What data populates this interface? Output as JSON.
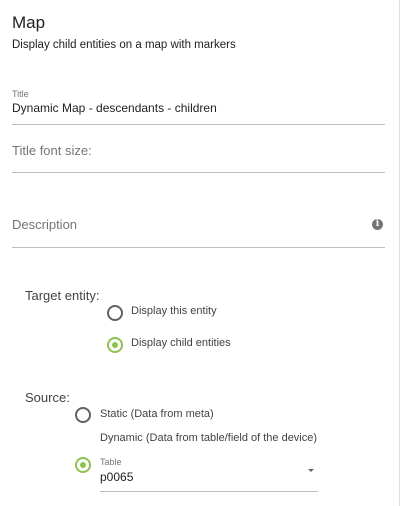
{
  "header": {
    "title": "Map",
    "subtitle": "Display child entities on a map with markers"
  },
  "fields": {
    "title": {
      "label": "Title",
      "value": "Dynamic Map - descendants - children"
    },
    "title_font_size": {
      "placeholder": "Title font size:"
    },
    "description": {
      "placeholder": "Description",
      "icon": "info-icon"
    }
  },
  "target_entity": {
    "label": "Target entity:",
    "options": [
      {
        "label": "Display this entity",
        "checked": false
      },
      {
        "label": "Display child entities",
        "checked": true
      }
    ]
  },
  "source": {
    "label": "Source:",
    "options": [
      {
        "label": "Static (Data from meta)",
        "checked": false
      },
      {
        "label": "Dynamic (Data from table/field of the device)",
        "checked": true
      }
    ],
    "table": {
      "label": "Table",
      "value": "p0065"
    }
  },
  "colors": {
    "accent": "#8bc34a"
  }
}
